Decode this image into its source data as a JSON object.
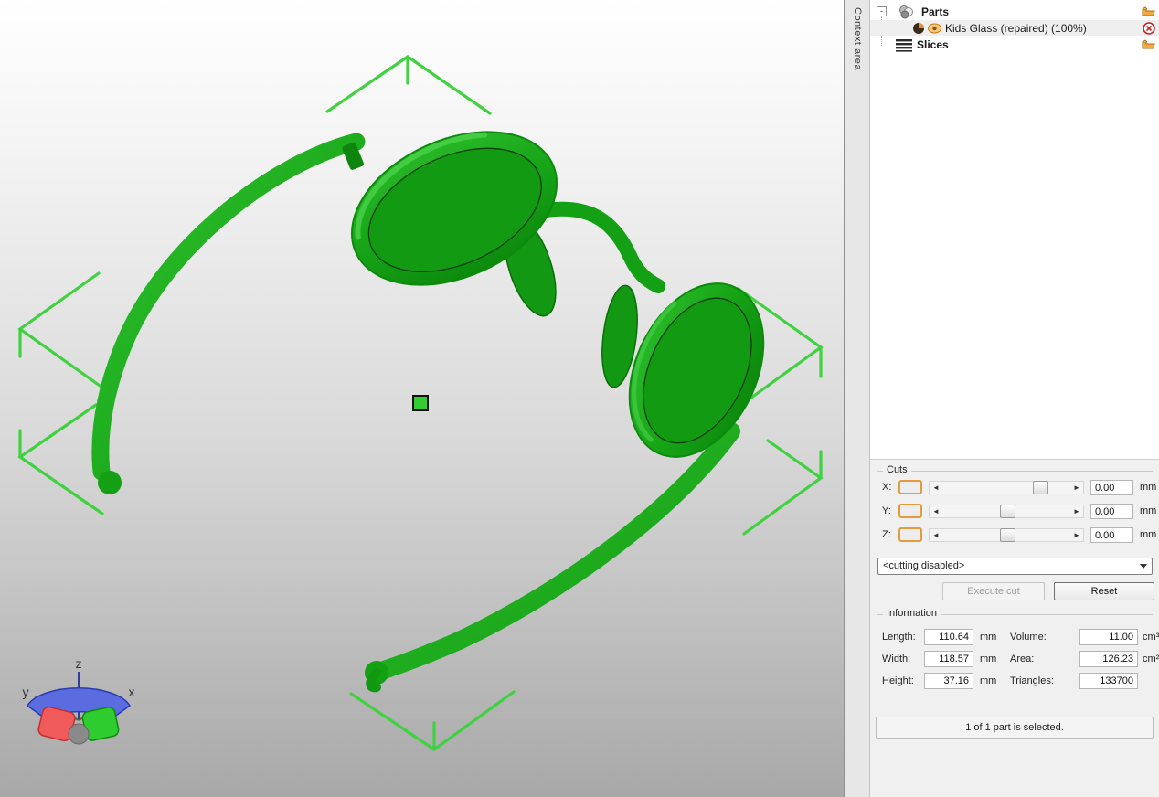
{
  "panel": {
    "context_tab": "Context area",
    "tree": {
      "parts_label": "Parts",
      "part_item_label": "Kids Glass (repaired) (100%)",
      "slices_label": "Slices",
      "expand_glyph": "-"
    },
    "cuts": {
      "title": "Cuts",
      "rows": [
        {
          "axis": "X:",
          "value": "0.00",
          "unit": "mm"
        },
        {
          "axis": "Y:",
          "value": "0.00",
          "unit": "mm"
        },
        {
          "axis": "Z:",
          "value": "0.00",
          "unit": "mm"
        }
      ],
      "arrow_left": "◄",
      "arrow_right": "►",
      "mode_selected": "<cutting disabled>",
      "execute_label": "Execute cut",
      "reset_label": "Reset"
    },
    "information": {
      "title": "Information",
      "fields_left": [
        {
          "label": "Length:",
          "value": "110.64",
          "unit": "mm"
        },
        {
          "label": "Width:",
          "value": "118.57",
          "unit": "mm"
        },
        {
          "label": "Height:",
          "value": "37.16",
          "unit": "mm"
        }
      ],
      "fields_right": [
        {
          "label": "Volume:",
          "value": "11.00",
          "unit": "cm³"
        },
        {
          "label": "Area:",
          "value": "126.23",
          "unit": "cm²"
        },
        {
          "label": "Triangles:",
          "value": "133700",
          "unit": ""
        }
      ]
    },
    "status": "1 of 1 part is selected."
  },
  "viewport": {
    "axis_labels": {
      "x": "x",
      "y": "y",
      "z": "z"
    },
    "colors": {
      "model_green": "#18a818",
      "model_dark_green": "#0b7d0b",
      "selection_green": "#3fd13f",
      "pivot_green": "#33cc33",
      "axis_x": "#b03a3a",
      "axis_y": "#2d7a2d",
      "axis_z": "#2d3f9e",
      "background_top": "#ffffff",
      "background_bottom": "#a8a8a8"
    }
  }
}
